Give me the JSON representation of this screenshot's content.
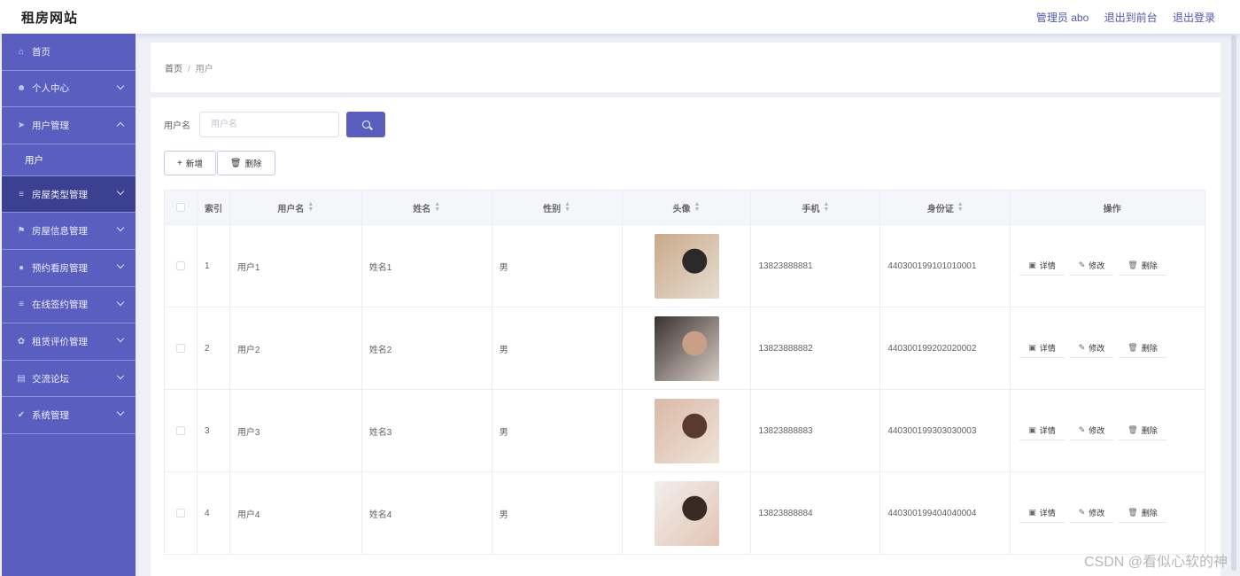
{
  "header": {
    "title": "租房网站",
    "admin": "管理员 abo",
    "exit_front": "退出到前台",
    "logout": "退出登录"
  },
  "sidebar": {
    "items": [
      {
        "label": "首页",
        "icon": "home-icon",
        "glyph": "⌂"
      },
      {
        "label": "个人中心",
        "icon": "person-icon",
        "glyph": "☻"
      },
      {
        "label": "用户管理",
        "icon": "send-icon",
        "glyph": "➤",
        "expanded": true,
        "sub": "用户"
      },
      {
        "label": "房屋类型管理",
        "icon": "list-icon",
        "glyph": "≡",
        "active": true
      },
      {
        "label": "房屋信息管理",
        "icon": "flag-icon",
        "glyph": "⚑"
      },
      {
        "label": "预约看房管理",
        "icon": "location-icon",
        "glyph": "●"
      },
      {
        "label": "在线签约管理",
        "icon": "list-icon",
        "glyph": "≡"
      },
      {
        "label": "租赁评价管理",
        "icon": "gear-icon",
        "glyph": "✿"
      },
      {
        "label": "交流论坛",
        "icon": "chat-icon",
        "glyph": "▤"
      },
      {
        "label": "系统管理",
        "icon": "thumb-icon",
        "glyph": "✔"
      }
    ]
  },
  "breadcrumb": {
    "home": "首页",
    "sep": "/",
    "current": "用户"
  },
  "search": {
    "label": "用户名",
    "placeholder": "用户名"
  },
  "actions": {
    "add": "新增",
    "delete": "删除"
  },
  "table": {
    "headers": {
      "index": "索引",
      "username": "用户名",
      "name": "姓名",
      "sex": "性别",
      "avatar": "头像",
      "phone": "手机",
      "idcard": "身份证",
      "ops": "操作"
    },
    "op_labels": {
      "detail": "详情",
      "edit": "修改",
      "delete": "删除"
    },
    "rows": [
      {
        "index": "1",
        "username": "用户1",
        "name": "姓名1",
        "sex": "男",
        "phone": "13823888881",
        "idcard": "440300199101010001",
        "avatar_colors": [
          "#c9a98a",
          "#2a2a2a",
          "#e6ddd0"
        ]
      },
      {
        "index": "2",
        "username": "用户2",
        "name": "姓名2",
        "sex": "男",
        "phone": "13823888882",
        "idcard": "440300199202020002",
        "avatar_colors": [
          "#3a3230",
          "#c99f85",
          "#d9cfc8"
        ]
      },
      {
        "index": "3",
        "username": "用户3",
        "name": "姓名3",
        "sex": "男",
        "phone": "13823888883",
        "idcard": "440300199303030003",
        "avatar_colors": [
          "#d9b8a6",
          "#5a3a2c",
          "#efe3d8"
        ]
      },
      {
        "index": "4",
        "username": "用户4",
        "name": "姓名4",
        "sex": "男",
        "phone": "13823888884",
        "idcard": "440300199404040004",
        "avatar_colors": [
          "#f1efee",
          "#3a2a24",
          "#e2c4b3"
        ]
      }
    ]
  },
  "watermark": "CSDN @看似心软的神"
}
